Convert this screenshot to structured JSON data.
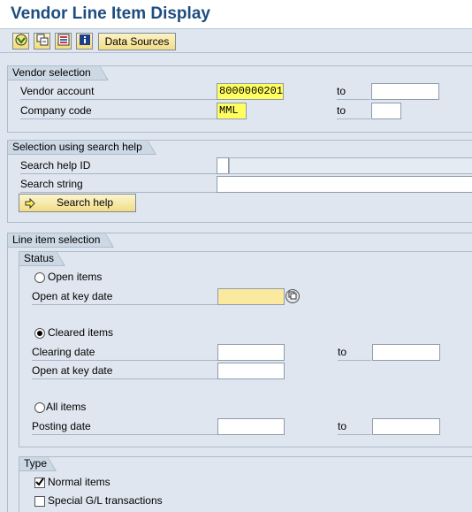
{
  "window": {
    "title": "Vendor Line Item Display"
  },
  "toolbar": {
    "execute_icon": "execute-icon",
    "get_variant_icon": "get-variant-icon",
    "selection_options_icon": "selection-options-icon",
    "info_icon": "info-icon",
    "data_sources_label": "Data Sources"
  },
  "vendor_selection": {
    "title": "Vendor selection",
    "vendor_account_label": "Vendor account",
    "vendor_account_value": "8000000201",
    "company_code_label": "Company code",
    "company_code_value": "MML",
    "to_label": "to"
  },
  "search_help": {
    "title": "Selection using search help",
    "search_help_id_label": "Search help ID",
    "search_string_label": "Search string",
    "search_help_button": "Search help"
  },
  "line_item_selection": {
    "title": "Line item selection",
    "status": {
      "title": "Status",
      "open_items_label": "Open items",
      "open_at_key_date_label": "Open at key date",
      "cleared_items_label": "Cleared items",
      "clearing_date_label": "Clearing date",
      "cleared_open_at_key_date_label": "Open at key date",
      "all_items_label": "All items",
      "posting_date_label": "Posting date",
      "to_label": "to",
      "selected": "cleared"
    },
    "type": {
      "title": "Type",
      "normal_items_label": "Normal items",
      "normal_items_checked": true,
      "special_gl_label": "Special G/L transactions",
      "special_gl_checked": false
    }
  }
}
